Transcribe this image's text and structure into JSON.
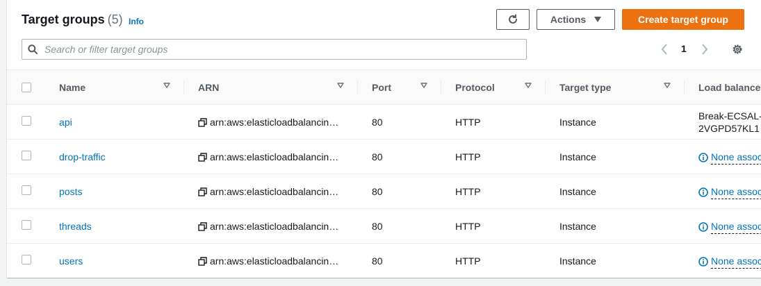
{
  "header": {
    "title": "Target groups",
    "count": "(5)",
    "info_label": "Info"
  },
  "toolbar": {
    "refresh_icon": "refresh-icon",
    "actions_label": "Actions",
    "create_label": "Create target group"
  },
  "search": {
    "placeholder": "Search or filter target groups",
    "value": ""
  },
  "pagination": {
    "current_page": "1"
  },
  "columns": [
    {
      "label": "Name"
    },
    {
      "label": "ARN"
    },
    {
      "label": "Port"
    },
    {
      "label": "Protocol"
    },
    {
      "label": "Target type"
    },
    {
      "label": "Load balancer"
    }
  ],
  "rows": [
    {
      "name": "api",
      "arn": "arn:aws:elasticloadbalancin…",
      "port": "80",
      "protocol": "HTTP",
      "target_type": "Instance",
      "lb_line1": "Break-ECSAL-",
      "lb_line2": "2VGPD57KL1"
    },
    {
      "name": "drop-traffic",
      "arn": "arn:aws:elasticloadbalancin…",
      "port": "80",
      "protocol": "HTTP",
      "target_type": "Instance",
      "lb_none": "None associated"
    },
    {
      "name": "posts",
      "arn": "arn:aws:elasticloadbalancin…",
      "port": "80",
      "protocol": "HTTP",
      "target_type": "Instance",
      "lb_none": "None associated"
    },
    {
      "name": "threads",
      "arn": "arn:aws:elasticloadbalancin…",
      "port": "80",
      "protocol": "HTTP",
      "target_type": "Instance",
      "lb_none": "None associated"
    },
    {
      "name": "users",
      "arn": "arn:aws:elasticloadbalancin…",
      "port": "80",
      "protocol": "HTTP",
      "target_type": "Instance",
      "lb_none": "None associated"
    }
  ],
  "colors": {
    "link": "#0073bb",
    "primary_button": "#ec7211",
    "text": "#16191f",
    "muted": "#687078"
  }
}
